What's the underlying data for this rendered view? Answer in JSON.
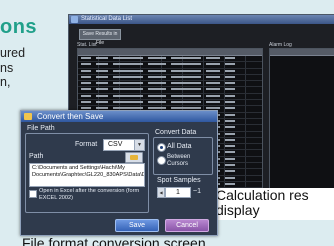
{
  "page": {
    "heading": "ons",
    "left_text": [
      "ured",
      "ns",
      "n,"
    ],
    "caption_right": "Calculation res display",
    "caption_bottom": "File format conversion screen"
  },
  "stat_window": {
    "title": "Statistical Data List",
    "button_label": "Save Results in File",
    "left_panel_title": "Stat. List",
    "right_panel_title": "Alarm Log"
  },
  "dialog": {
    "title": "Convert then Save",
    "file_path_label": "File Path",
    "format_label": "Format",
    "format_value": "CSV",
    "path_label": "Path",
    "path_value": "C:\\Documents and Settings\\Hachi\\My Documents\\Graphtec\\GL220_830APS\\Data\\Default.csv",
    "open_excel_label": "Open in Excel after the conversion (form EXCEL 2002)",
    "convert_data_label": "Convert Data",
    "all_data_label": "All Data",
    "between_cursors_label": "Between Cursors",
    "spot_samples_label": "Spot Samples",
    "spot_value": "1",
    "spot_suffix": "~1",
    "save_label": "Save",
    "cancel_label": "Cancel"
  }
}
